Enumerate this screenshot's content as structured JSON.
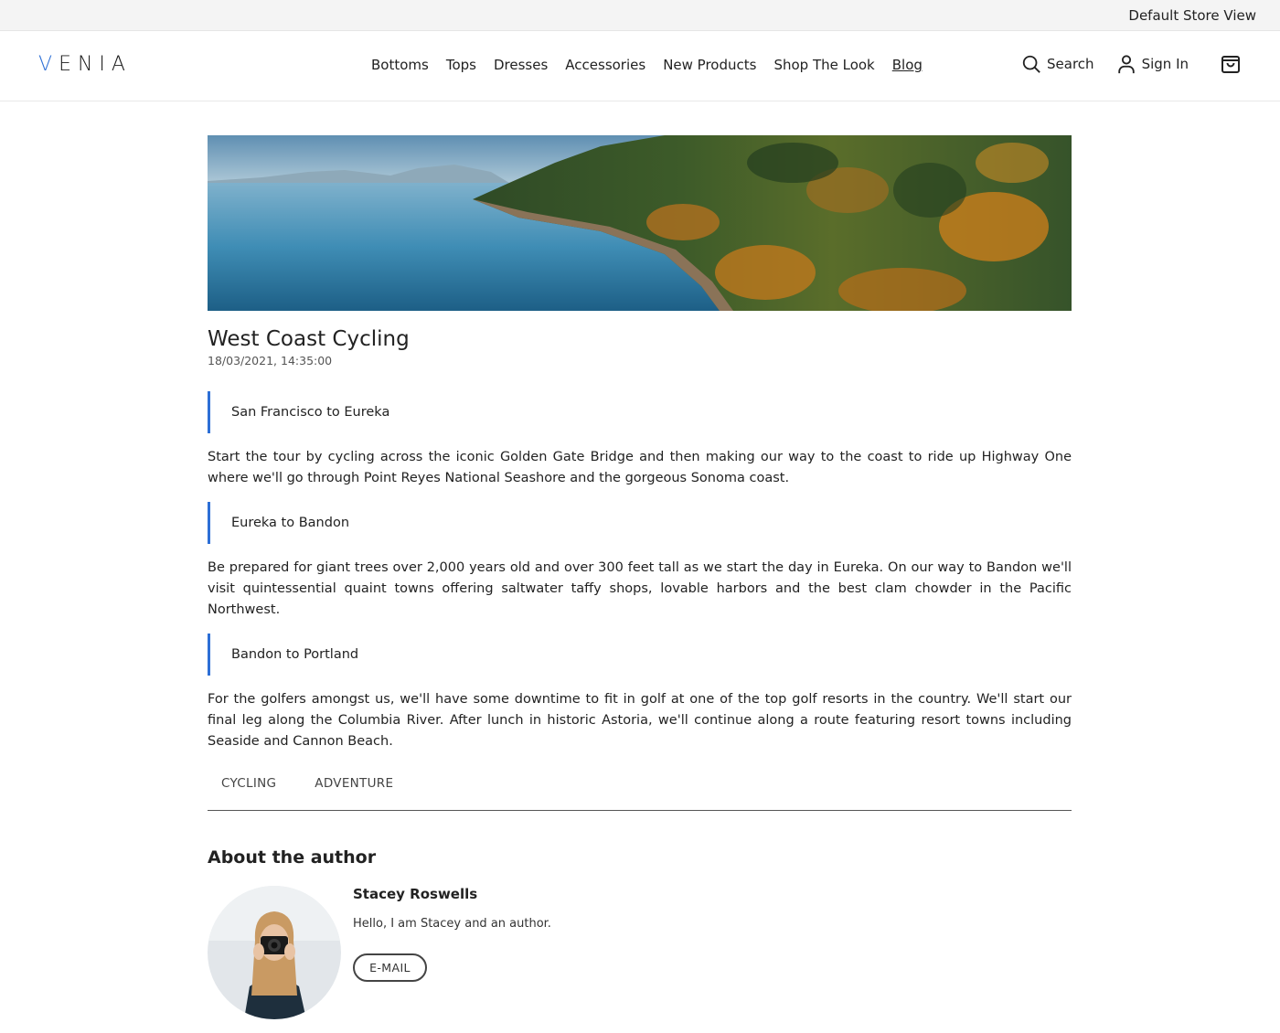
{
  "topbar": {
    "store_view": "Default Store View"
  },
  "header": {
    "logo_first": "V",
    "logo_rest": "ENIA",
    "nav": [
      "Bottoms",
      "Tops",
      "Dresses",
      "Accessories",
      "New Products",
      "Shop The Look",
      "Blog"
    ],
    "search_label": "Search",
    "signin_label": "Sign In",
    "icons": [
      "search-icon",
      "user-icon",
      "cart-icon"
    ]
  },
  "post": {
    "title": "West Coast Cycling",
    "date": "18/03/2021, 14:35:00",
    "sections": [
      {
        "heading": "San Francisco to Eureka",
        "text": "Start the tour by cycling across the iconic Golden Gate Bridge and then making our way to the coast to ride up Highway One  where we'll go through Point Reyes National Seashore and the gorgeous Sonoma coast."
      },
      {
        "heading": "Eureka to Bandon",
        "text": "Be prepared for giant trees over 2,000 years old and over 300 feet tall as we start the day in Eureka. On our way to Bandon we'll visit quintessential quaint towns offering saltwater taffy shops, lovable harbors and the best clam chowder in the Pacific Northwest."
      },
      {
        "heading": "Bandon to Portland",
        "text": "For the golfers amongst us, we'll have some downtime to fit in golf at one of the top golf resorts in the country. We'll start our final leg along the Columbia River. After lunch in historic Astoria, we'll continue along a route featuring resort towns including Seaside and Cannon Beach."
      }
    ],
    "tags": [
      "CYCLING",
      "ADVENTURE"
    ]
  },
  "author": {
    "section_title": "About the author",
    "name": "Stacey Roswells",
    "bio": "Hello, I am Stacey and an author.",
    "email_label": "E-MAIL"
  },
  "colors": {
    "accent": "#2d6fd6",
    "topbar_bg": "#f4f4f4"
  }
}
